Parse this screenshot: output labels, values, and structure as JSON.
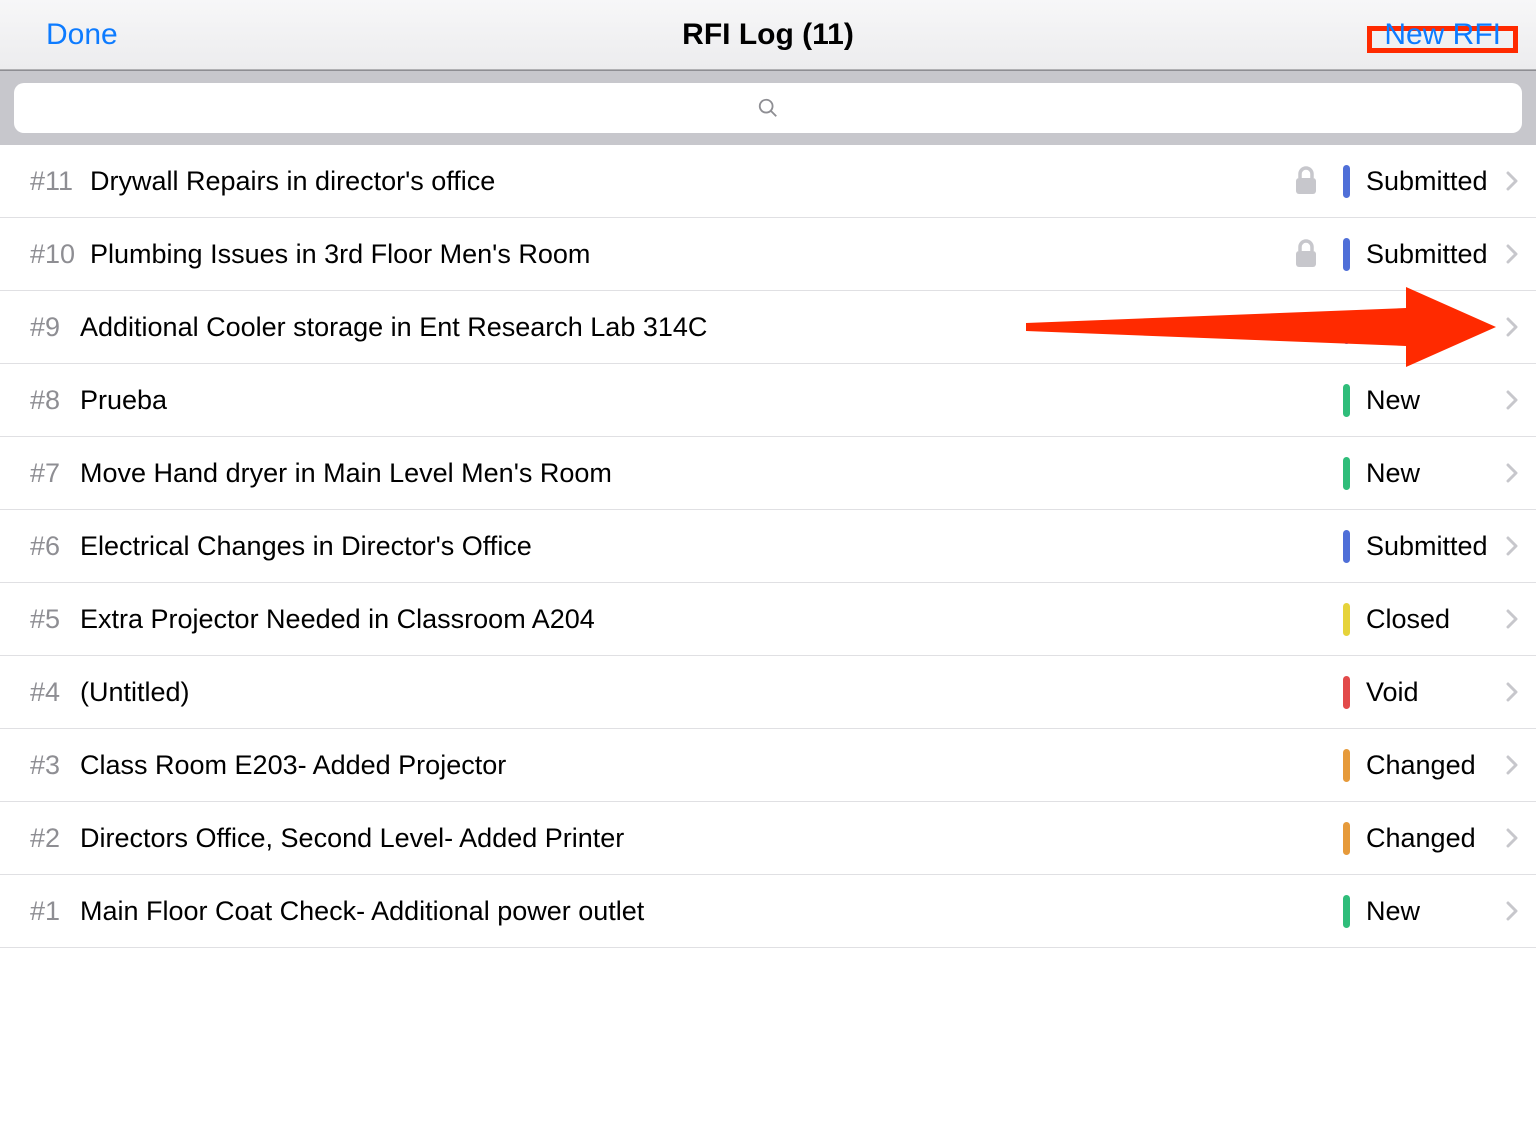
{
  "colors": {
    "accent": "#0d7bff",
    "highlight_box": "#ff2a00",
    "arrow": "#ff2a00",
    "status": {
      "submitted": "#4f6fd8",
      "new": "#2fbd7a",
      "closed": "#e6d33a",
      "void": "#e24a4a",
      "changed": "#e69a3a"
    }
  },
  "nav": {
    "left_label": "Done",
    "title": "RFI Log (11)",
    "right_label": "New RFI"
  },
  "search": {
    "placeholder": ""
  },
  "rows": [
    {
      "num": "#11",
      "title": "Drywall Repairs in director's office",
      "locked": true,
      "status_key": "submitted",
      "status_text": "Submitted",
      "hide_status_text": false
    },
    {
      "num": "#10",
      "title": "Plumbing Issues in 3rd Floor Men's Room",
      "locked": true,
      "status_key": "submitted",
      "status_text": "Submitted",
      "hide_status_text": false
    },
    {
      "num": "#9",
      "title": "Additional Cooler storage in Ent Research Lab 314C",
      "locked": false,
      "status_key": "submitted",
      "status_text": "",
      "hide_status_text": true
    },
    {
      "num": "#8",
      "title": "Prueba",
      "locked": false,
      "status_key": "new",
      "status_text": "New",
      "hide_status_text": false
    },
    {
      "num": "#7",
      "title": "Move Hand dryer in Main Level Men's Room",
      "locked": false,
      "status_key": "new",
      "status_text": "New",
      "hide_status_text": false
    },
    {
      "num": "#6",
      "title": "Electrical Changes in Director's Office",
      "locked": false,
      "status_key": "submitted",
      "status_text": "Submitted",
      "hide_status_text": false
    },
    {
      "num": "#5",
      "title": "Extra Projector Needed in Classroom A204",
      "locked": false,
      "status_key": "closed",
      "status_text": "Closed",
      "hide_status_text": false
    },
    {
      "num": "#4",
      "title": "(Untitled)",
      "locked": false,
      "status_key": "void",
      "status_text": "Void",
      "hide_status_text": false
    },
    {
      "num": "#3",
      "title": "Class Room E203- Added Projector",
      "locked": false,
      "status_key": "changed",
      "status_text": "Changed",
      "hide_status_text": false
    },
    {
      "num": "#2",
      "title": "Directors Office, Second Level-  Added Printer",
      "locked": false,
      "status_key": "changed",
      "status_text": "Changed",
      "hide_status_text": false
    },
    {
      "num": "#1",
      "title": "Main Floor Coat Check- Additional power outlet",
      "locked": false,
      "status_key": "new",
      "status_text": "New",
      "hide_status_text": false
    }
  ],
  "annotations": {
    "highlight_new_rfi": true,
    "arrow_row_index": 2
  }
}
